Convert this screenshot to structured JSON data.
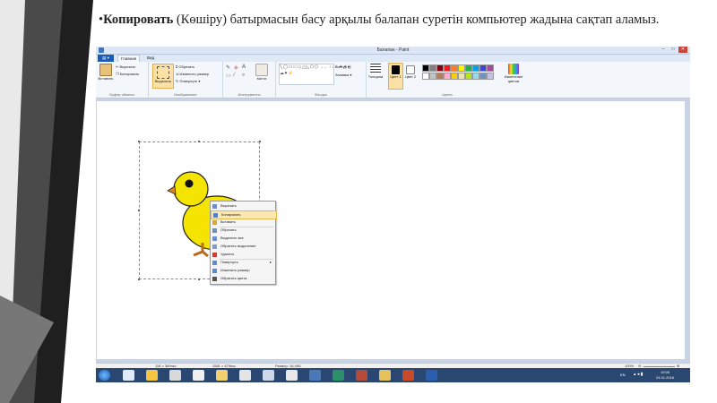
{
  "caption": {
    "bullet": "•",
    "bold": "Копировать",
    "rest": " (Көшіру) батырмасын басу арқылы балапан суретін компьютер жадына сақтап аламыз."
  },
  "window": {
    "title": "Балапан - Paint",
    "minimize": "–",
    "maximize": "□",
    "close": "✕"
  },
  "tabs": {
    "file": "▤ ▾",
    "home": "Главная",
    "view": "Вид"
  },
  "ribbon": {
    "clipboard": {
      "paste": "Вставить",
      "cut": "Вырезать",
      "copy": "Копировать",
      "label": "Буфер обмена"
    },
    "image": {
      "select": "Выделить",
      "crop": "Обрезать",
      "resize": "Изменить размер",
      "rotate": "Повернуть ▾",
      "label": "Изображение"
    },
    "tools": {
      "label": "Инструменты",
      "brushes": "Кисти"
    },
    "shapes": {
      "outline": "Контур ▾",
      "fill": "Заливка ▾",
      "label": "Фигуры"
    },
    "thickness": "Толщина",
    "color1": "Цвет 1",
    "color2": "Цвет 2",
    "colors_label": "Цвета",
    "edit_colors": "Изменение цветов",
    "palette": [
      "#000000",
      "#7f7f7f",
      "#880015",
      "#ed1c24",
      "#ff7f27",
      "#fff200",
      "#22b14c",
      "#00a2e8",
      "#3f48cc",
      "#a349a4",
      "#ffffff",
      "#c3c3c3",
      "#b97a57",
      "#ffaec9",
      "#ffc90e",
      "#efe4b0",
      "#b5e61d",
      "#99d9ea",
      "#7092be",
      "#c8bfe7"
    ]
  },
  "context_menu": {
    "items": [
      {
        "label": "Вырезать",
        "icon": "scissors-icon"
      },
      {
        "label": "Копировать",
        "icon": "copy-icon"
      },
      {
        "label": "Вставить",
        "icon": "paste-icon"
      },
      {
        "label": "Обрезать",
        "icon": "crop-icon"
      },
      {
        "label": "Выделить все",
        "icon": "select-all-icon"
      },
      {
        "label": "Обратить выделение",
        "icon": "invert-selection-icon"
      },
      {
        "label": "Удалить",
        "icon": "delete-icon"
      },
      {
        "label": "Повернуть",
        "icon": "rotate-icon",
        "arrow": "▸"
      },
      {
        "label": "Изменить размер",
        "icon": "resize-icon"
      },
      {
        "label": "Обратить цвета",
        "icon": "invert-colors-icon"
      }
    ],
    "highlighted_index": 1
  },
  "statusbar": {
    "pos": "118 × 369пкс",
    "selection": "1581 × 679пкс",
    "size": "Размер: 16,4КБ",
    "zoom": "100%",
    "zoom_out": "⊖",
    "zoom_in": "⊕"
  },
  "taskbar": {
    "lang": "EN",
    "time": "10:05",
    "date": "24.01.2016"
  }
}
